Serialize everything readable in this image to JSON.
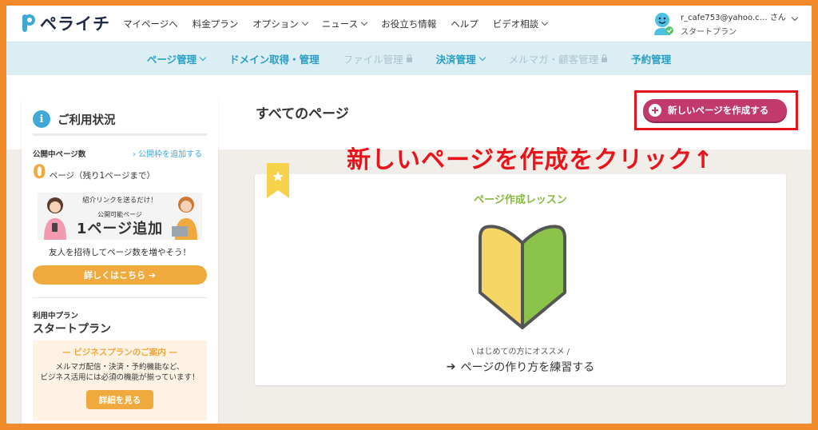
{
  "header": {
    "logo_text": "ペライチ",
    "nav": [
      {
        "label": "マイページへ",
        "dropdown": false
      },
      {
        "label": "料金プラン",
        "dropdown": false
      },
      {
        "label": "オプション",
        "dropdown": true
      },
      {
        "label": "ニュース",
        "dropdown": true
      },
      {
        "label": "お役立ち情報",
        "dropdown": false
      },
      {
        "label": "ヘルプ",
        "dropdown": false
      },
      {
        "label": "ビデオ相談",
        "dropdown": true
      }
    ],
    "user": {
      "email": "r_cafe753@yahoo.c…",
      "suffix": "さん",
      "plan": "スタートプラン"
    }
  },
  "subnav": [
    {
      "label": "ページ管理",
      "dropdown": true,
      "disabled": false
    },
    {
      "label": "ドメイン取得・管理",
      "dropdown": false,
      "disabled": false
    },
    {
      "label": "ファイル管理",
      "dropdown": false,
      "disabled": true
    },
    {
      "label": "決済管理",
      "dropdown": true,
      "disabled": false
    },
    {
      "label": "メルマガ・顧客管理",
      "dropdown": false,
      "disabled": true
    },
    {
      "label": "予約管理",
      "dropdown": false,
      "disabled": false
    }
  ],
  "main": {
    "page_title": "すべてのページ",
    "create_button": "新しいページを作成する",
    "annotation": "新しいページを作成をクリック↑",
    "lesson": {
      "title": "ページ作成レッスン",
      "small": "\\ はじめての方にオススメ /",
      "link": "ページの作り方を練習する"
    }
  },
  "sidebar": {
    "title": "ご利用状況",
    "published_label": "公開中ページ数",
    "add_link": "› 公開枠を追加する",
    "count": "0",
    "count_text": "ページ（残り1ページまで）",
    "banner": {
      "small": "紹介リンクを送るだけ！",
      "sub": "公開可能ページ",
      "big": "1ページ追加"
    },
    "invite_text": "友人を招待してページ数を増やそう！",
    "details_button": "詳しくはこちら ➔",
    "plan_label": "利用中プラン",
    "plan_name": "スタートプラン",
    "promo": {
      "title": "— ビジネスプランのご案内 —",
      "line1": "メルマガ配信・決済・予約機能など、",
      "line2": "ビジネス活用には必須の機能が揃っています！",
      "button": "詳細を見る"
    }
  },
  "colors": {
    "frame": "#f18a2b",
    "accent_blue": "#2a9fc4",
    "create_button": "#c23a6c",
    "annotation_red": "#e8141c",
    "orange": "#f0a93c",
    "lesson_green": "#88b83f"
  },
  "icons": {
    "logo": "p-logo-icon",
    "avatar": "smiley-avatar-icon",
    "info": "info-icon",
    "plus": "plus-circle-icon",
    "ribbon": "star-bookmark-icon",
    "leaf": "beginner-mark-icon",
    "arrow": "arrow-right-icon"
  }
}
